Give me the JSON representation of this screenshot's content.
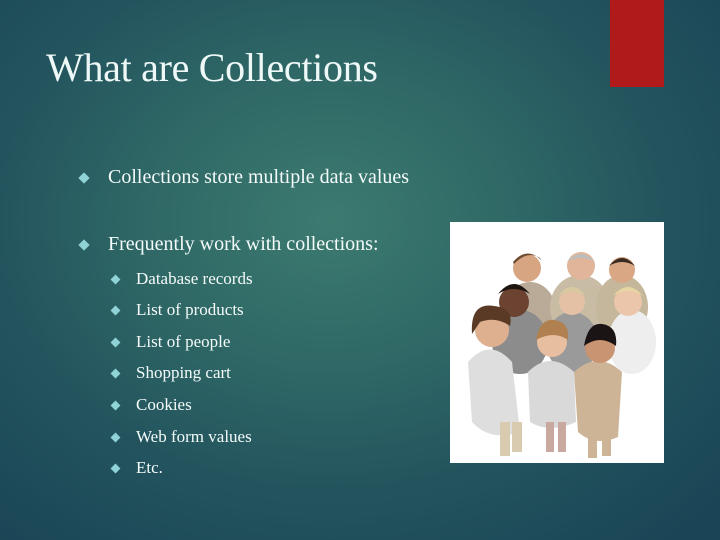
{
  "slide": {
    "title": "What are Collections",
    "accent_color": "#b01a1a",
    "bullet_color": "#8fd3d6",
    "bullets": [
      {
        "text": "Collections store multiple data values",
        "icon": "diamond-bullet-icon"
      },
      {
        "text": "Frequently work with collections:",
        "icon": "diamond-bullet-icon"
      }
    ],
    "sub_bullets": [
      {
        "text": "Database records",
        "icon": "diamond-bullet-icon"
      },
      {
        "text": "List of products",
        "icon": "diamond-bullet-icon"
      },
      {
        "text": "List of people",
        "icon": "diamond-bullet-icon"
      },
      {
        "text": "Shopping cart",
        "icon": "diamond-bullet-icon"
      },
      {
        "text": "Cookies",
        "icon": "diamond-bullet-icon"
      },
      {
        "text": "Web form values",
        "icon": "diamond-bullet-icon"
      },
      {
        "text": "Etc.",
        "icon": "diamond-bullet-icon"
      }
    ],
    "image": {
      "description": "Group of smiling people looking up at the camera"
    }
  }
}
